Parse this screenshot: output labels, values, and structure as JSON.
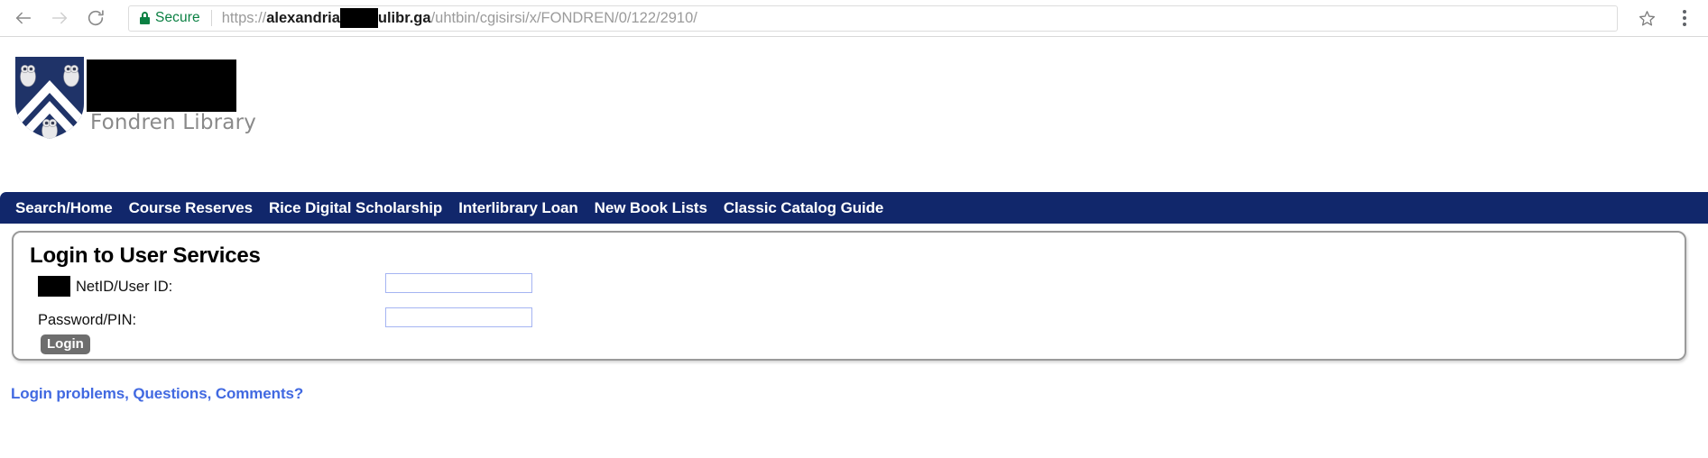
{
  "browser": {
    "back_icon": "arrow-left-icon",
    "forward_icon": "arrow-right-icon",
    "reload_icon": "reload-icon",
    "security_label": "Secure",
    "lock_icon": "lock-icon",
    "url": {
      "scheme": "https://",
      "host_visible_start": "alexandria",
      "host_redacted": "",
      "host_visible_end": "ulibr.ga",
      "path": "/uhtbin/cgisirsi/x/FONDREN/0/122/2910/",
      "full_display": "https://alexandria[REDACTED]ulibr.ga/uhtbin/cgisirsi/x/FONDREN/0/122/2910/"
    },
    "bookmark_icon": "star-icon",
    "menu_icon": "three-dot-menu-icon"
  },
  "header": {
    "logo_alt": "rice-owl-shield-logo",
    "wordmark_redacted": "",
    "library_name": "Fondren Library"
  },
  "nav": {
    "items": [
      {
        "label": "Search/Home"
      },
      {
        "label": "Course Reserves"
      },
      {
        "label": "Rice Digital Scholarship"
      },
      {
        "label": "Interlibrary Loan"
      },
      {
        "label": "New Book Lists"
      },
      {
        "label": "Classic Catalog Guide"
      }
    ]
  },
  "login": {
    "title": "Login to User Services",
    "username_redacted_prefix": "",
    "username_label": "NetID/User ID:",
    "username_value": "",
    "username_placeholder": "",
    "password_label": "Password/PIN:",
    "password_value": "",
    "password_placeholder": "",
    "submit_label": "Login"
  },
  "footer": {
    "help_link": "Login problems, Questions, Comments?"
  },
  "colors": {
    "nav_navy": "#11276b",
    "shield_navy": "#1f3368",
    "secure_green": "#0b8043",
    "link_blue": "#4169e1",
    "button_gray": "#6e6e6e",
    "input_border": "#a5b4f2"
  }
}
